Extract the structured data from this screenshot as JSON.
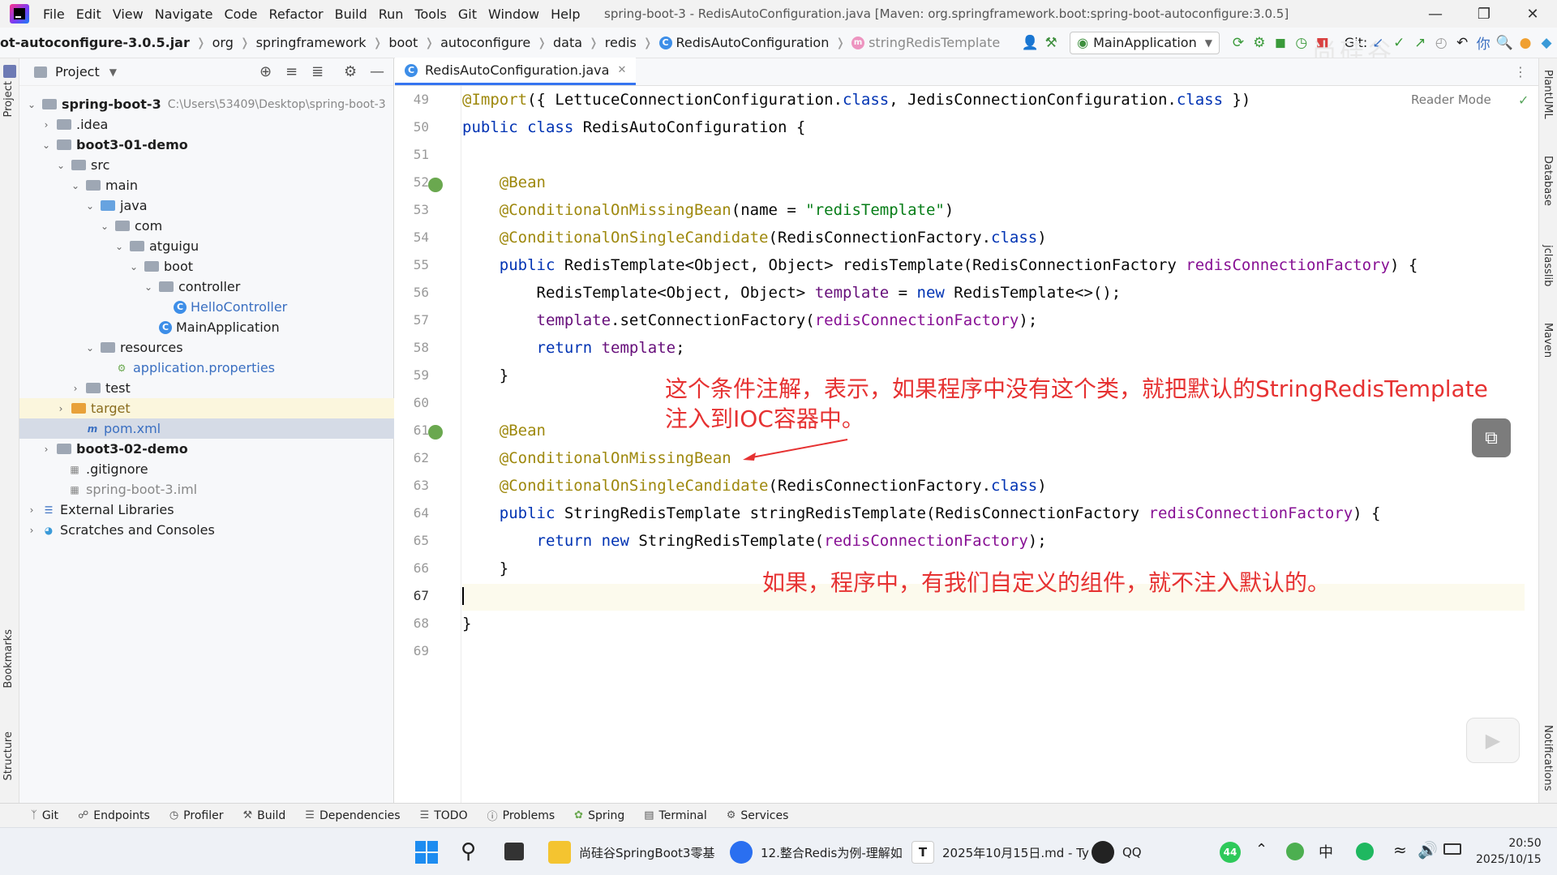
{
  "menu": [
    "File",
    "Edit",
    "View",
    "Navigate",
    "Code",
    "Refactor",
    "Build",
    "Run",
    "Tools",
    "Git",
    "Window",
    "Help"
  ],
  "window_title": "spring-boot-3 - RedisAutoConfiguration.java [Maven: org.springframework.boot:spring-boot-autoconfigure:3.0.5]",
  "breadcrumbs": [
    "ot-autoconfigure-3.0.5.jar",
    "org",
    "springframework",
    "boot",
    "autoconfigure",
    "data",
    "redis",
    "RedisAutoConfiguration",
    "stringRedisTemplate"
  ],
  "toolbar": {
    "run_config": "MainApplication",
    "git_label": "Git:"
  },
  "watermark": "尚硅谷",
  "project_panel": {
    "title": "Project",
    "tree": [
      {
        "label": "spring-boot-3",
        "path": "C:\\Users\\53409\\Desktop\\spring-boot-3"
      },
      {
        "label": ".idea"
      },
      {
        "label": "boot3-01-demo"
      },
      {
        "label": "src"
      },
      {
        "label": "main"
      },
      {
        "label": "java"
      },
      {
        "label": "com"
      },
      {
        "label": "atguigu"
      },
      {
        "label": "boot"
      },
      {
        "label": "controller"
      },
      {
        "label": "HelloController"
      },
      {
        "label": "MainApplication"
      },
      {
        "label": "resources"
      },
      {
        "label": "application.properties"
      },
      {
        "label": "test"
      },
      {
        "label": "target"
      },
      {
        "label": "pom.xml"
      },
      {
        "label": "boot3-02-demo"
      },
      {
        "label": ".gitignore"
      },
      {
        "label": "spring-boot-3.iml"
      },
      {
        "label": "External Libraries"
      },
      {
        "label": "Scratches and Consoles"
      }
    ]
  },
  "editor": {
    "tab": "RedisAutoConfiguration.java",
    "reader_mode": "Reader Mode",
    "line_numbers": [
      "49",
      "50",
      "51",
      "52",
      "53",
      "54",
      "55",
      "56",
      "57",
      "58",
      "59",
      "60",
      "61",
      "62",
      "63",
      "64",
      "65",
      "66",
      "67",
      "68",
      "69"
    ],
    "current_line": "67"
  },
  "annotations": {
    "note1_line1": "这个条件注解，表示，如果程序中没有这个类，就把默认的StringRedisTemplate",
    "note1_line2": "注入到IOC容器中。",
    "note2": "如果，程序中，有我们自定义的组件，就不注入默认的。"
  },
  "left_tabs": [
    "Project",
    "Bookmarks",
    "Structure"
  ],
  "right_tabs": [
    "PlantUML",
    "Database",
    "jclasslib",
    "Maven",
    "Notifications"
  ],
  "bottom_tabs": [
    "Git",
    "Endpoints",
    "Profiler",
    "Build",
    "Dependencies",
    "TODO",
    "Problems",
    "Spring",
    "Terminal",
    "Services"
  ],
  "taskbar": {
    "apps": [
      "尚硅谷SpringBoot3零基",
      "12.整合Redis为例-理解如",
      "2025年10月15日.md - Ty",
      "QQ"
    ],
    "badge": "44",
    "ime": "中",
    "time": "20:50",
    "date": "2025/10/15"
  }
}
